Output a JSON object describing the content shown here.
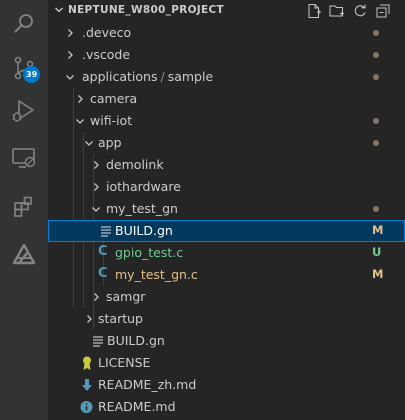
{
  "activity_bar": {
    "items": [
      {
        "icon": "search-icon"
      },
      {
        "icon": "source-control-icon",
        "badge": "39"
      },
      {
        "icon": "run-debug-icon"
      },
      {
        "icon": "remote-explorer-icon"
      },
      {
        "icon": "extensions-icon"
      },
      {
        "icon": "deveco-icon"
      }
    ]
  },
  "explorer": {
    "title": "NEPTUNE_W800_PROJECT",
    "actions": [
      "new-file-icon",
      "new-folder-icon",
      "refresh-icon",
      "collapse-all-icon"
    ],
    "rows": [
      {
        "label": ".deveco",
        "type": "folder",
        "expanded": false,
        "status": "dot"
      },
      {
        "label": ".vscode",
        "type": "folder",
        "expanded": false,
        "status": "dot"
      },
      {
        "label_parts": [
          "applications",
          "/",
          "sample"
        ],
        "type": "folder",
        "expanded": true,
        "status": "dot"
      },
      {
        "label": "camera",
        "type": "folder",
        "expanded": false
      },
      {
        "label": "wifi-iot",
        "type": "folder",
        "expanded": true,
        "status": "dot"
      },
      {
        "label": "app",
        "type": "folder",
        "expanded": true,
        "status": "dot"
      },
      {
        "label": "demolink",
        "type": "folder",
        "expanded": false
      },
      {
        "label": "iothardware",
        "type": "folder",
        "expanded": false
      },
      {
        "label": "my_test_gn",
        "type": "folder",
        "expanded": true,
        "status": "dot"
      },
      {
        "label": "BUILD.gn",
        "type": "file",
        "status": "M",
        "selected": true
      },
      {
        "label": "gpio_test.c",
        "type": "file-c",
        "status": "U"
      },
      {
        "label": "my_test_gn.c",
        "type": "file-c",
        "status": "M"
      },
      {
        "label": "samgr",
        "type": "folder",
        "expanded": false
      },
      {
        "label": "startup",
        "type": "folder",
        "expanded": false
      },
      {
        "label": "BUILD.gn",
        "type": "file"
      },
      {
        "label": "LICENSE",
        "type": "license"
      },
      {
        "label": "README_zh.md",
        "type": "markdown"
      },
      {
        "label": "README.md",
        "type": "info"
      }
    ]
  },
  "colors": {
    "activity_bar_bg": "#333333",
    "sidebar_bg": "#252526",
    "selection_bg": "#04395e",
    "selection_border": "#007fd4",
    "badge_bg": "#007acc",
    "modified": "#e2c08d",
    "untracked": "#73c991",
    "c_icon": "#519aba"
  }
}
